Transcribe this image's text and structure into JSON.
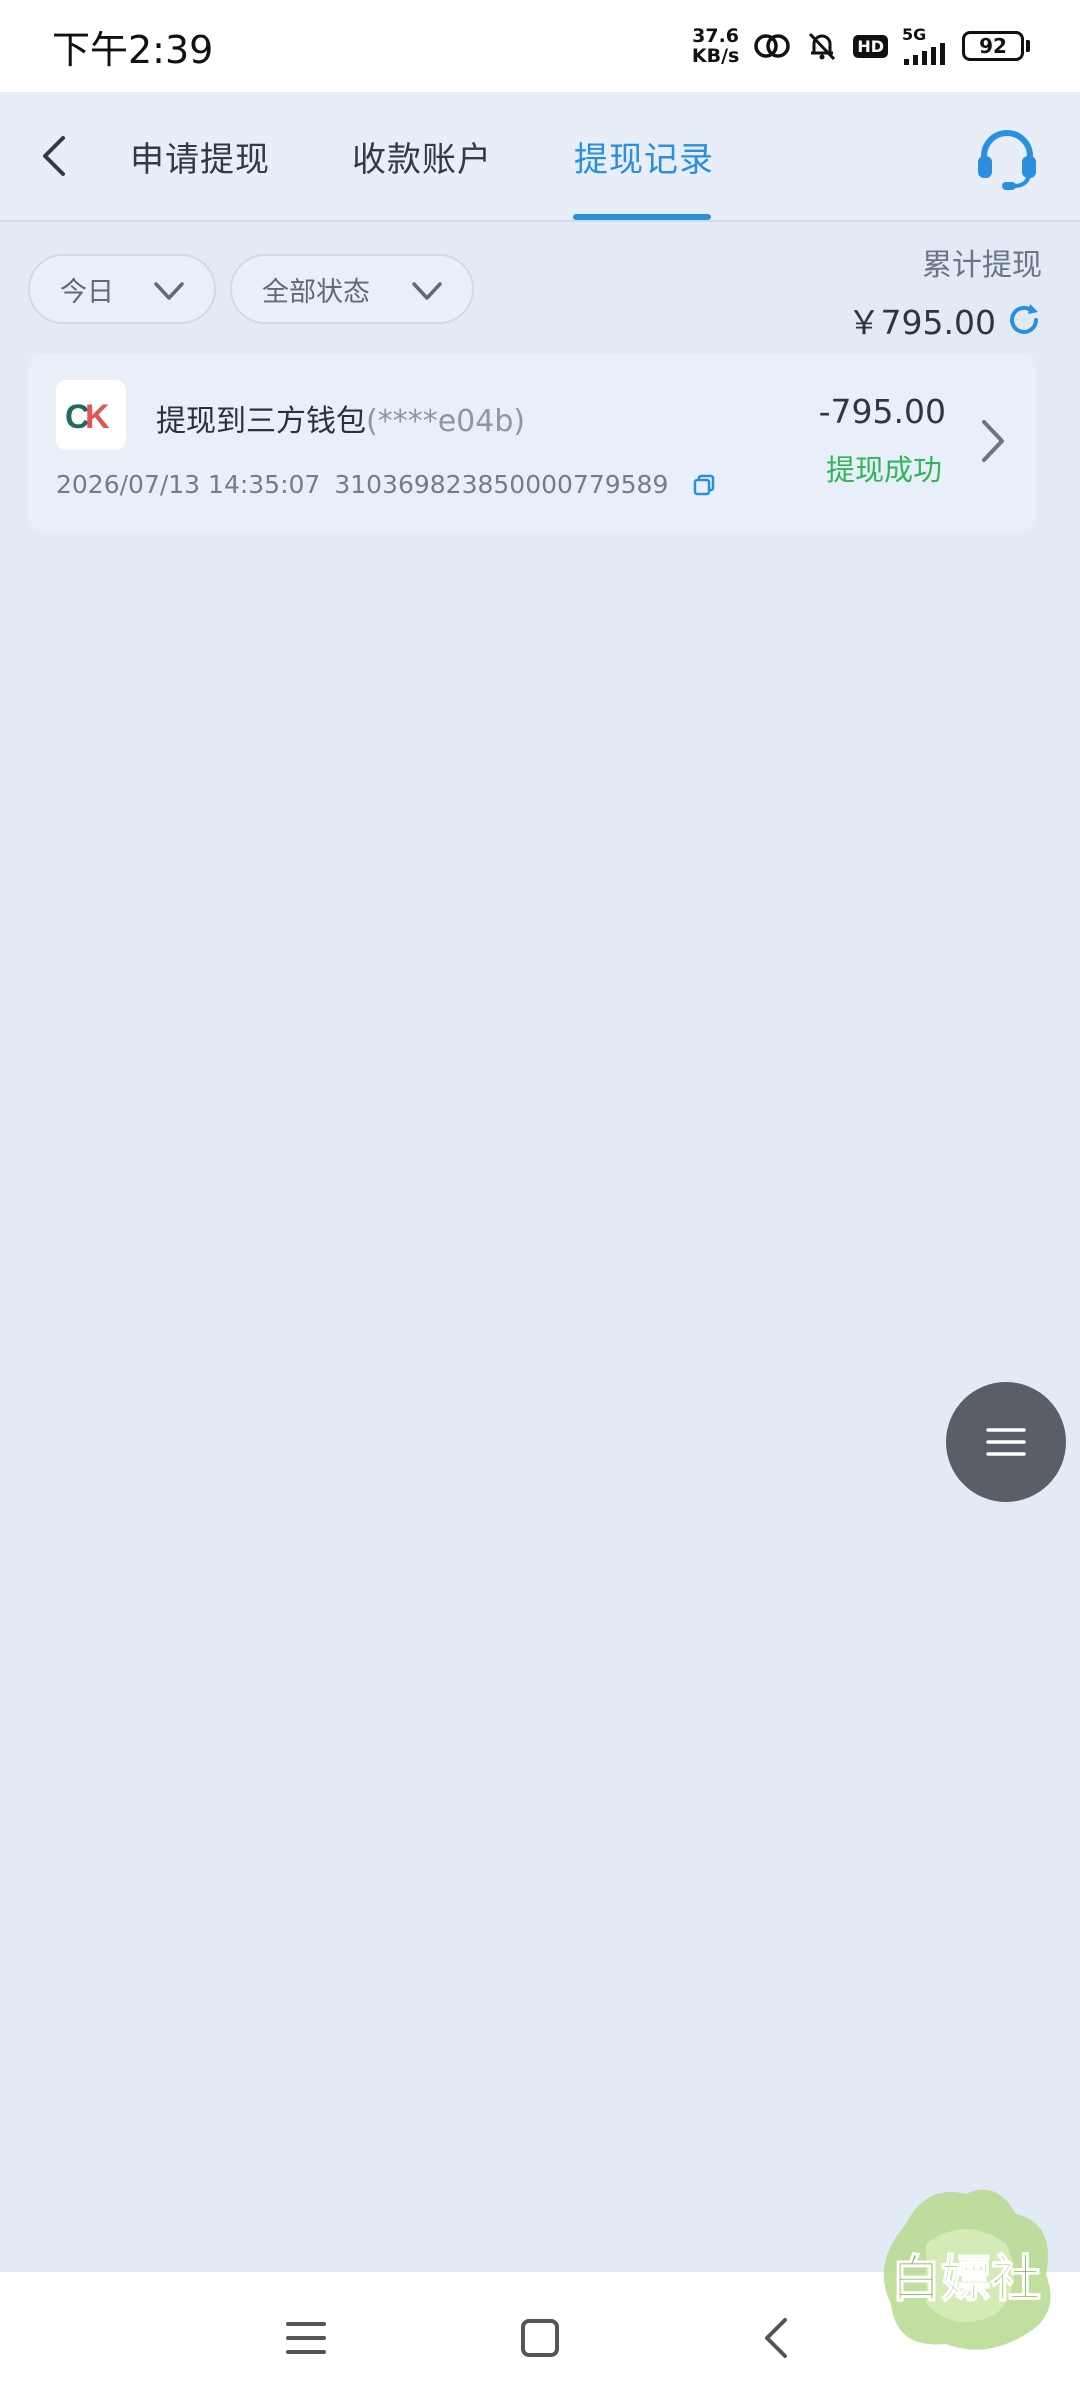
{
  "status_bar": {
    "time": "下午2:39",
    "net_speed_value": "37.6",
    "net_speed_unit": "KB/s",
    "hd": "HD",
    "network": "5G",
    "battery": "92"
  },
  "nav": {
    "tabs": [
      {
        "label": "申请提现",
        "active": false
      },
      {
        "label": "收款账户",
        "active": false
      },
      {
        "label": "提现记录",
        "active": true
      }
    ],
    "accent_color": "#2b8fe0"
  },
  "filters": {
    "date": "今日",
    "status": "全部状态"
  },
  "summary": {
    "label": "累计提现",
    "amount": "￥795.00"
  },
  "records": [
    {
      "title": "提现到三方钱包",
      "account_mask": "(****e04b)",
      "datetime": "2026/07/13 14:35:07",
      "order_no": "310369823850000779589",
      "amount": "-795.00",
      "status": "提现成功",
      "status_color": "#32b45a"
    }
  ],
  "logo_text": {
    "c": "C",
    "k": "K"
  },
  "watermark": {
    "text": "白嫖社"
  },
  "icons": {
    "back": "chevron-left-icon",
    "support": "headset-icon",
    "refresh": "refresh-icon",
    "copy": "copy-icon",
    "float_menu": "menu-icon",
    "nav_menu": "menu-icon",
    "nav_home": "square-icon",
    "nav_back": "chevron-left-icon"
  }
}
